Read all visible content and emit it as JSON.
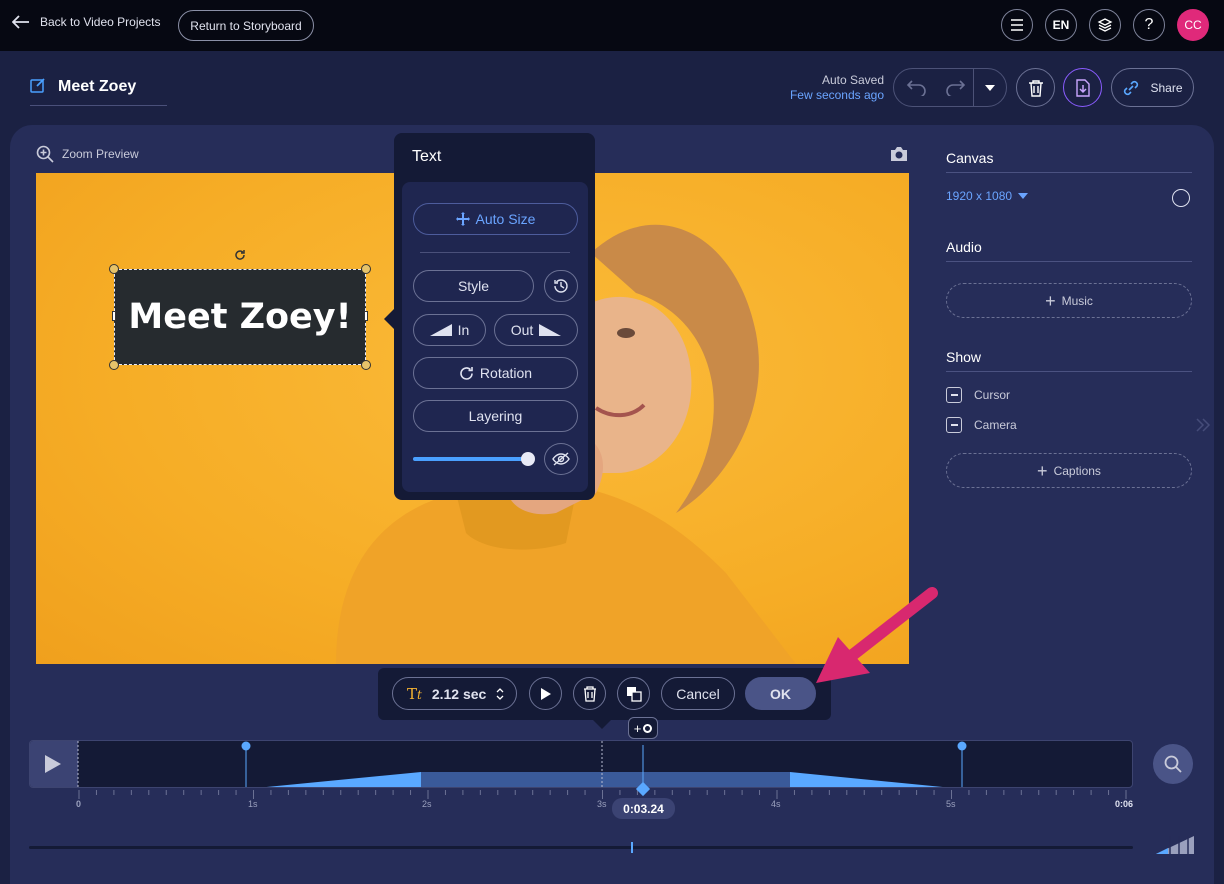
{
  "topbar": {
    "back_label": "Back to Video Projects",
    "storyboard_label": "Return to Storyboard",
    "language": "EN",
    "help": "?",
    "avatar_initials": "CC"
  },
  "header": {
    "project_title": "Meet Zoey",
    "autosave_label": "Auto Saved",
    "autosave_time": "Few seconds ago",
    "share_label": "Share"
  },
  "preview": {
    "zoom_label": "Zoom Preview",
    "text_overlay": "Meet Zoey!"
  },
  "text_panel": {
    "title": "Text",
    "auto_size": "Auto Size",
    "style": "Style",
    "in": "In",
    "out": "Out",
    "rotation": "Rotation",
    "layering": "Layering",
    "opacity": 1.0
  },
  "sidebar": {
    "canvas_heading": "Canvas",
    "canvas_size": "1920 x 1080",
    "audio_heading": "Audio",
    "music_button": "Music",
    "show_heading": "Show",
    "cursor_label": "Cursor",
    "camera_label": "Camera",
    "captions_button": "Captions"
  },
  "toolbar": {
    "duration": "2.12 sec",
    "cancel": "Cancel",
    "ok": "OK"
  },
  "timeline": {
    "ticks": [
      "0",
      "1s",
      "2s",
      "3s",
      "4s",
      "5s",
      "0:06"
    ],
    "current_time": "0:03.24"
  },
  "colors": {
    "accent_blue": "#5aa8ff",
    "annotation_pink": "#d8286f",
    "avatar_bg": "#e0297a",
    "canvas_bg": "#f6ad26"
  }
}
